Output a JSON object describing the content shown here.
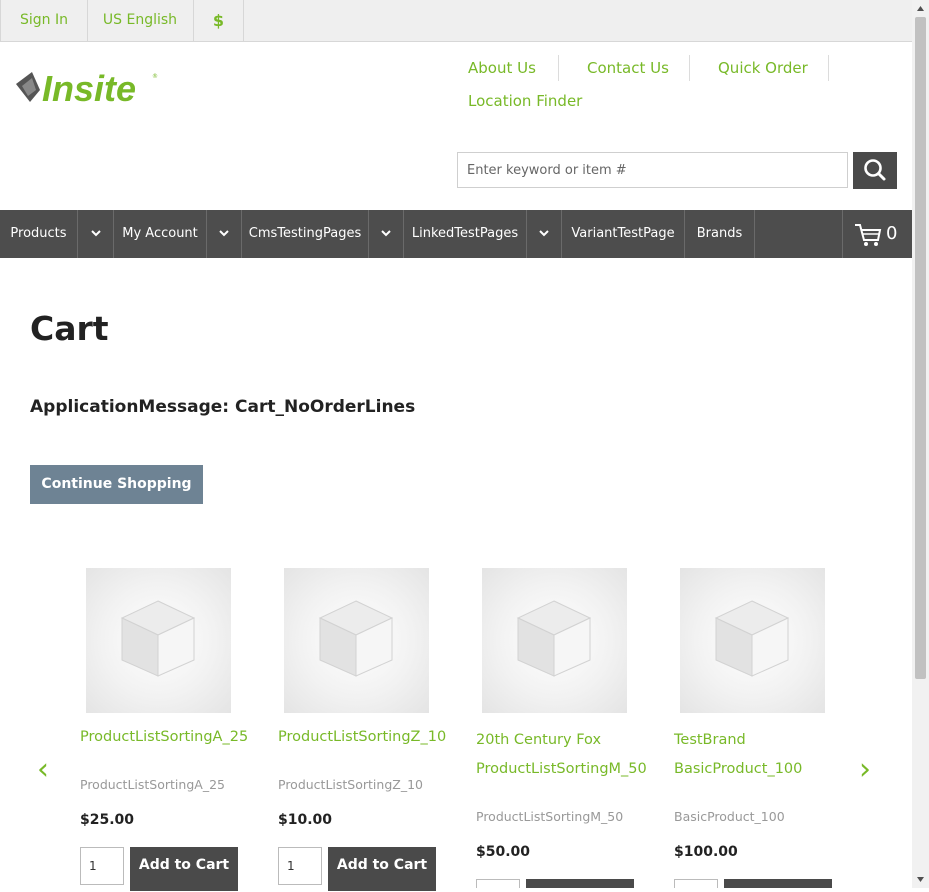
{
  "topbar": {
    "sign_in": "Sign In",
    "language": "US English",
    "currency": "$"
  },
  "logo": {
    "text": "Insite"
  },
  "utility_links": [
    "About Us",
    "Contact Us",
    "Quick Order",
    "Location Finder"
  ],
  "search": {
    "placeholder": "Enter keyword or item #"
  },
  "nav": {
    "items": [
      "Products",
      "My Account",
      "CmsTestingPages",
      "LinkedTestPages",
      "VariantTestPage",
      "Brands"
    ],
    "cart_count": "0"
  },
  "page": {
    "title": "Cart",
    "message": "ApplicationMessage: Cart_NoOrderLines",
    "continue_label": "Continue Shopping"
  },
  "carousel": {
    "prev": "‹",
    "next": "›",
    "products": [
      {
        "name": "ProductListSortingA_25",
        "sku": "ProductListSortingA_25",
        "price": "$25.00",
        "qty": "1",
        "add_label": "Add to Cart"
      },
      {
        "name": "ProductListSortingZ_10",
        "sku": "ProductListSortingZ_10",
        "price": "$10.00",
        "qty": "1",
        "add_label": "Add to Cart"
      },
      {
        "name_line1": "20th Century Fox",
        "name_line2": "ProductListSortingM_50",
        "sku": "ProductListSortingM_50",
        "price": "$50.00"
      },
      {
        "name_line1": "TestBrand",
        "name_line2": "BasicProduct_100",
        "sku": "BasicProduct_100",
        "price": "$100.00"
      }
    ]
  },
  "colors": {
    "accent": "#78b928",
    "nav_bg": "#4d4d4d",
    "button_gray": "#6e8394"
  }
}
